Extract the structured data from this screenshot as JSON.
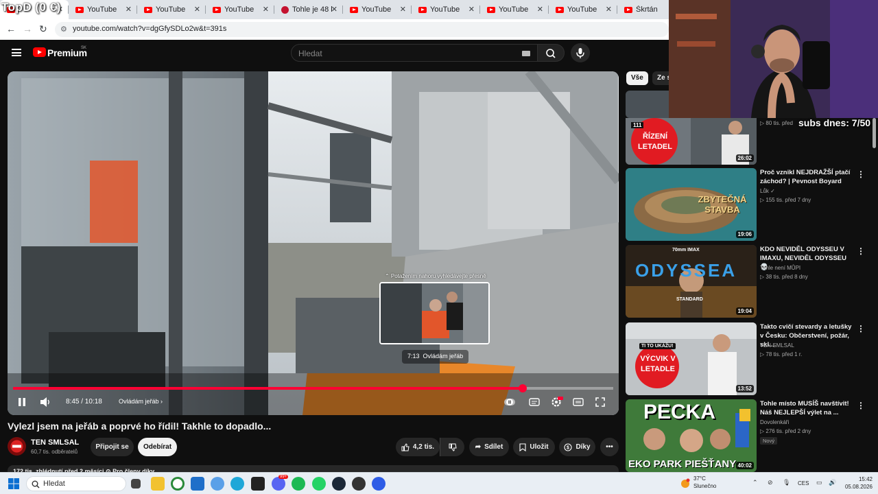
{
  "overlay": {
    "watermark": "TopD (0 €)",
    "subs_goal": "subs dnes: 7/50"
  },
  "browser": {
    "tabs": [
      {
        "label": "",
        "active": true,
        "icon": "youtube-icon"
      },
      {
        "label": "YouTube",
        "icon": "youtube-icon"
      },
      {
        "label": "YouTube",
        "icon": "youtube-icon"
      },
      {
        "label": "YouTube",
        "icon": "youtube-icon"
      },
      {
        "label": "Tohle je 48 hrá",
        "icon": "site-icon"
      },
      {
        "label": "YouTube",
        "icon": "youtube-icon"
      },
      {
        "label": "YouTube",
        "icon": "youtube-icon"
      },
      {
        "label": "YouTube",
        "icon": "youtube-icon"
      },
      {
        "label": "YouTube",
        "icon": "youtube-icon"
      },
      {
        "label": "Škrtán",
        "icon": "youtube-icon"
      }
    ],
    "url": "youtube.com/watch?v=dgGfySDLo2w&t=391s"
  },
  "youtube": {
    "brand": "Premium",
    "region": "SK",
    "search_placeholder": "Hledat"
  },
  "player": {
    "seek_hint": "⌃ Potažením nahoru vyhledávejte přesně",
    "preview_time": "7:13",
    "preview_chapter": "Ovládám jeřáb",
    "current_time": "8:45",
    "duration": "10:18",
    "time_display": "8:45 / 10:18",
    "chapter": "Ovládám jeřáb",
    "progress_fraction": 0.849,
    "hover_fraction": 0.7,
    "accent": "#ff0033"
  },
  "video": {
    "title": "Vylezl jsem na jeřáb a poprvé ho řídil! Takhle to dopadlo...",
    "channel": "TEN SMLSAL",
    "subscribers": "60,7 tis. odběratelů",
    "join_label": "Připojit se",
    "subscribe_label": "Odebírat",
    "likes": "4,2 tis.",
    "share_label": "Sdílet",
    "save_label": "Uložit",
    "thanks_label": "Díky",
    "meta": "172 tis. zhlédnutí  před 2 měsíci  ⊙ Pro členy díky"
  },
  "sidebar": {
    "chips": [
      "Vše",
      "Ze s"
    ],
    "recommendations": [
      {
        "thumb_text": "ŘÍZENÍ LETADEL",
        "thumb_top_text": "111",
        "duration": "26:02",
        "title": "",
        "channel": "",
        "stats": "▷ 80 tis.   před",
        "badge": ""
      },
      {
        "thumb_text": "ZBYTEČNÁ STAVBA",
        "duration": "19:06",
        "title": "Proč vznikl NEJDRAŽŠÍ ptačí záchod? | Pevnost Boyard",
        "channel": "Lůk ✓",
        "stats": "▷ 155 tis.   před 7 dny",
        "badge": ""
      },
      {
        "thumb_text": "ODYSSEA",
        "thumb_top_text": "70mm IMAX",
        "thumb_bottom_text": "STANDARD",
        "duration": "19:04",
        "title": "KDO NEVIDĚL ODYSSEU V IMAXU, NEVIDĚL ODYSSEU 💀",
        "channel": "Tohle není MŮPI",
        "stats": "▷ 38 tis.   před 8 dny",
        "badge": ""
      },
      {
        "thumb_text": "VÝCVIK V LETADLE",
        "thumb_top_text": "TI TO UKÁŽU!",
        "duration": "13:52",
        "title": "Takto cvičí stevardy a letušky v Česku: Občerstvení, požár, skl...",
        "channel": "TEN SMLSAL",
        "stats": "▷ 78 tis.   před 1 r.",
        "badge": ""
      },
      {
        "thumb_text": "PECKA",
        "thumb_bottom_text": "EKO PARK PIEŠŤANY",
        "duration": "40:02",
        "title": "Tohle místo MUSÍŠ navštívit! Náš NEJLEPŠÍ výlet na ...",
        "channel": "Dovolenkáři",
        "stats": "▷ 276 tis.   před 2 dny",
        "badge": "Nový"
      }
    ]
  },
  "taskbar": {
    "search_placeholder": "Hledat",
    "temperature": "37°C",
    "weather": "Slunečno",
    "language": "CES",
    "time": "15:42",
    "date": "05.08.2026",
    "chat_badge": "99+"
  }
}
